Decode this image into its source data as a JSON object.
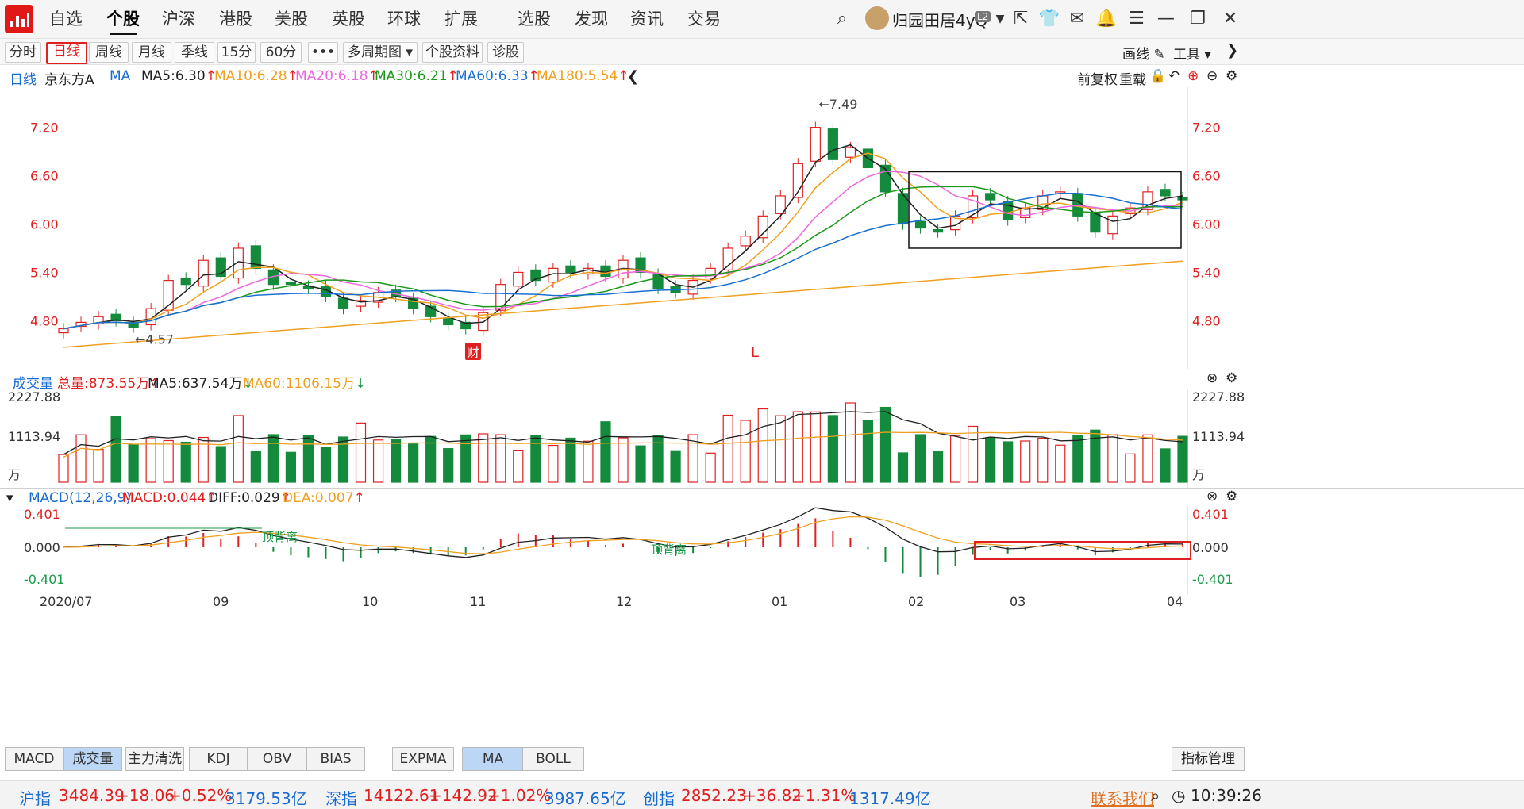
{
  "topnav": {
    "items": [
      {
        "label": "自选"
      },
      {
        "label": "个股"
      },
      {
        "label": "沪深"
      },
      {
        "label": "港股"
      },
      {
        "label": "美股"
      },
      {
        "label": "英股"
      },
      {
        "label": "环球"
      },
      {
        "label": "扩展"
      },
      {
        "label": "选股"
      },
      {
        "label": "发现"
      },
      {
        "label": "资讯"
      },
      {
        "label": "交易"
      }
    ],
    "active": "个股",
    "username": "归园田居4yQ",
    "user_badge": "L2"
  },
  "periodbar": {
    "buttons": [
      "分时",
      "日线",
      "周线",
      "月线",
      "季线",
      "15分",
      "60分",
      "•••",
      "多周期图 ▾",
      "个股资料",
      "诊股"
    ],
    "active": "日线",
    "draw_label": "画线",
    "tools_label": "工具 ▾"
  },
  "mabar": {
    "period": "日线",
    "stock_name": "京东方A",
    "indicator": "MA",
    "ma5": "MA5:6.30",
    "ma10": "MA10:6.28",
    "ma20": "MA20:6.18",
    "ma30": "MA30:6.21",
    "ma60": "MA60:6.33",
    "ma180": "MA180:5.54",
    "adjust_label": "前复权",
    "overlay_label": "重载",
    "colors": {
      "ma5": "#222222",
      "ma10": "#f0a020",
      "ma20": "#ee66dd",
      "ma30": "#1a9a1a",
      "ma60": "#1a70d0",
      "ma180": "#f0a020"
    }
  },
  "main_chart": {
    "price_ticks": [
      "7.20",
      "6.60",
      "6.00",
      "5.40",
      "4.80"
    ],
    "high_label": "7.49",
    "low_label": "4.57",
    "marker_fin": "财",
    "marker_l": "L"
  },
  "volume": {
    "title": "成交量",
    "total": "总量:873.55万",
    "ma5": "MA5:637.54万",
    "ma60": "MA60:1106.15万",
    "ticks": [
      "2227.88",
      "1113.94",
      "万"
    ]
  },
  "macd": {
    "title": "MACD(12,26,9)",
    "macd": "MACD:0.044",
    "diff": "DIFF:0.029",
    "dea": "DEA:0.007",
    "ticks": [
      "0.401",
      "0.000",
      "-0.401"
    ],
    "annot1": "顶背离",
    "annot2": "顶背离"
  },
  "xaxis": [
    "2020/07",
    "09",
    "10",
    "11",
    "12",
    "01",
    "02",
    "03",
    "04"
  ],
  "bottom_tabs_left": [
    "MACD",
    "成交量",
    "主力清洗",
    "KDJ",
    "OBV",
    "BIAS"
  ],
  "bottom_tabs_right": [
    "EXPMA",
    "MA",
    "BOLL"
  ],
  "indicator_manage": "指标管理",
  "statusbar": {
    "sh": {
      "name": "沪指",
      "price": "3484.39",
      "chg": "+18.06",
      "pct": "+0.52%",
      "amt": "3179.53亿"
    },
    "sz": {
      "name": "深指",
      "price": "14122.61",
      "chg": "+142.92",
      "pct": "+1.02%",
      "amt": "3987.65亿"
    },
    "cy": {
      "name": "创指",
      "price": "2852.23",
      "chg": "+36.82",
      "pct": "+1.31%",
      "amt": "1317.49亿"
    },
    "contact": "联系我们",
    "time": "10:39:26"
  },
  "chart_data": {
    "type": "candlestick",
    "title": "京东方A 日线",
    "ylim": [
      4.4,
      7.6
    ],
    "x_range": [
      "2020/07",
      "2021/04"
    ],
    "close_approx": [
      4.7,
      4.78,
      4.85,
      4.8,
      4.72,
      4.95,
      5.3,
      5.25,
      5.55,
      5.35,
      5.7,
      5.45,
      5.25,
      5.25,
      5.2,
      5.1,
      4.95,
      5.05,
      5.15,
      5.1,
      4.95,
      4.85,
      4.75,
      4.7,
      4.9,
      5.25,
      5.4,
      5.3,
      5.45,
      5.4,
      5.45,
      5.35,
      5.55,
      5.4,
      5.2,
      5.15,
      5.3,
      5.45,
      5.7,
      5.85,
      6.1,
      6.35,
      6.75,
      7.2,
      6.8,
      6.95,
      6.7,
      6.4,
      6.0,
      5.95,
      5.9,
      6.1,
      6.35,
      6.3,
      6.05,
      6.2,
      6.35,
      6.4,
      6.1,
      5.9,
      6.1,
      6.2,
      6.4,
      6.35,
      6.3
    ]
  }
}
